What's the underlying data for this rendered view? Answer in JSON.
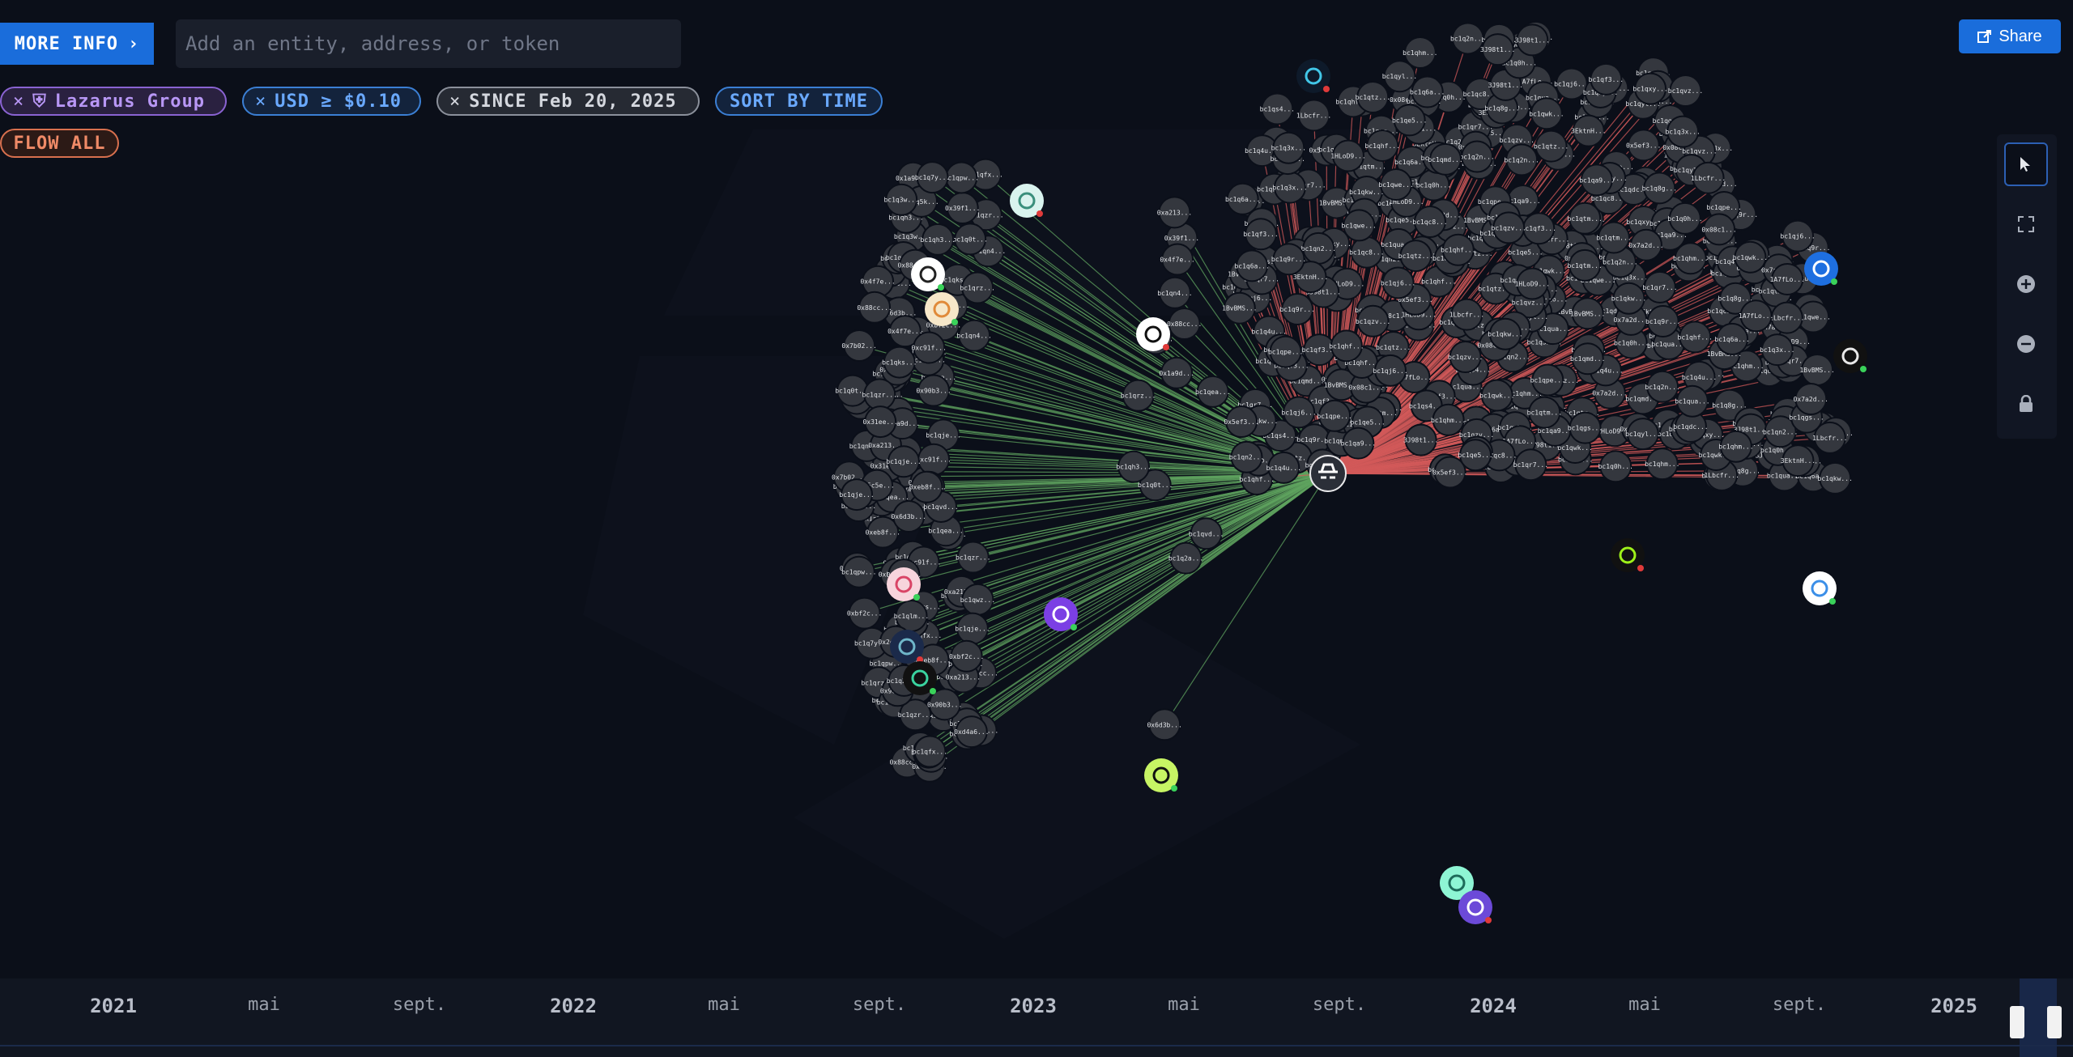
{
  "toolbar": {
    "more_info_label": "MORE INFO",
    "search_placeholder": "Add an entity, address, or token",
    "share_label": "Share"
  },
  "filters": {
    "entity": "Lazarus Group",
    "usd": "USD ≥ $0.10",
    "since": "SINCE Feb 20, 2025",
    "sort": "SORT BY TIME",
    "flow": "FLOW ALL"
  },
  "colors": {
    "accent": "#1a6ddb",
    "inflow_edge": "#5fa35f",
    "outflow_edge": "#d25a5a",
    "node": "#3a3d44"
  },
  "side_tools": [
    "select-icon",
    "fit-icon",
    "zoom-in-icon",
    "zoom-out-icon",
    "lock-icon"
  ],
  "timeline": {
    "years": [
      "2021",
      "2022",
      "2023",
      "2024",
      "2025"
    ],
    "months": [
      "mai",
      "sept.",
      "mai",
      "sept.",
      "mai",
      "sept.",
      "mai",
      "sept."
    ]
  },
  "graph": {
    "left_labels": [
      "0xbf2c...",
      "bc1qpw...",
      "bc1q3w...",
      "bc1qje...",
      "0xeb8f...",
      "bc1qea...",
      "0x5c5e...",
      "bc1qrz...",
      "0x6d3b...",
      "bc1qvd...",
      "0x39f1...",
      "bc1qn4...",
      "0x1a9d...",
      "bc1q0t...",
      "0x88cc...",
      "bc1q2a...",
      "0x4f7e...",
      "bc1qh3...",
      "0xa213...",
      "bc1qwz...",
      "0x7b02...",
      "bc1qlm...",
      "0xc91f...",
      "bc1q5k...",
      "0x2e8d...",
      "bc1qfx...",
      "0xd4a6...",
      "bc1qzr...",
      "0x90b3...",
      "bc1q7y...",
      "0x31ee...",
      "bc1qks..."
    ],
    "right_labels": [
      "bc1qxy...",
      "bc1q2n...",
      "bc1qhf...",
      "0x7a2d...",
      "bc1q9r...",
      "bc1qtm...",
      "bc1qwk...",
      "1A7fLo...",
      "bc1q8g...",
      "3J98t1...",
      "bc1qzv...",
      "bc1qmd...",
      "0x5ef3...",
      "bc1qdc...",
      "bc1q4u...",
      "1BvBMS...",
      "bc1qua...",
      "bc1qpe...",
      "bc1qj6...",
      "bc1qgs...",
      "0x08c1...",
      "bc1qr7...",
      "bc1q0h...",
      "1Lbcfr...",
      "bc1qn2...",
      "bc1qe5...",
      "bc1qkw...",
      "3EktnH...",
      "bc1qf3...",
      "bc1qyl...",
      "bc1qc8...",
      "bc1qvz...",
      "bc1q6a...",
      "bc1qs4...",
      "1HLoD9...",
      "bc1qtz...",
      "bc1qhm...",
      "bc1qa9...",
      "bc1q3x...",
      "bc1qwe..."
    ],
    "center": {
      "name": "lazarus-group-hub"
    }
  }
}
